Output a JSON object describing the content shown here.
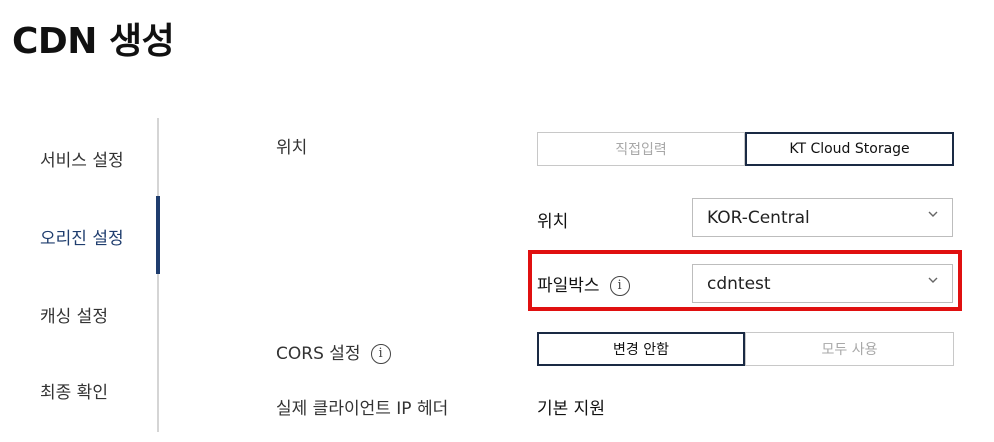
{
  "page": {
    "title": "CDN 생성"
  },
  "sidebar": {
    "items": [
      {
        "label": "서비스 설정",
        "active": false
      },
      {
        "label": "오리진 설정",
        "active": true
      },
      {
        "label": "캐싱 설정",
        "active": false
      },
      {
        "label": "최종 확인",
        "active": false
      }
    ]
  },
  "form": {
    "location": {
      "label": "위치",
      "options": [
        {
          "label": "직접입력",
          "selected": false
        },
        {
          "label": "KT Cloud Storage",
          "selected": true
        }
      ]
    },
    "region": {
      "label": "위치",
      "value": "KOR-Central"
    },
    "filebox": {
      "label": "파일박스",
      "value": "cdntest",
      "info_icon": "info-icon"
    },
    "cors": {
      "label": "CORS 설정",
      "info_icon": "info-icon",
      "options": [
        {
          "label": "변경 안함",
          "selected": true
        },
        {
          "label": "모두 사용",
          "selected": false
        }
      ]
    },
    "client_ip_header": {
      "label": "실제 클라이언트 IP 헤더",
      "value": "기본 지원"
    }
  },
  "colors": {
    "accent": "#1f3d6e",
    "highlight": "#e01010"
  }
}
